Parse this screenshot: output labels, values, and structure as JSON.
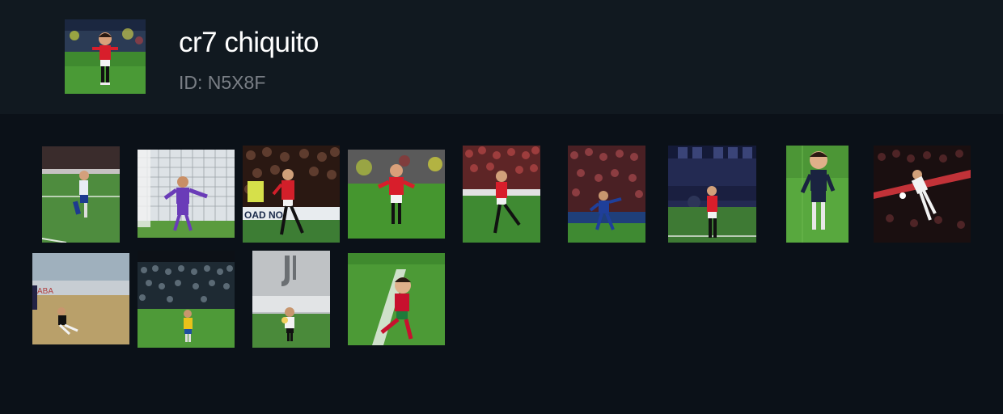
{
  "collection": {
    "title": "cr7 chiquito",
    "id_text": "ID: N5X8F"
  },
  "gallery": {
    "items": [
      {
        "scene": "white-kit-small-player",
        "kit": "#e9ecf5"
      },
      {
        "scene": "purple-kit-goal-net",
        "kit": "#6a3cb8"
      },
      {
        "scene": "red-kit-crowd-night",
        "kit": "#d21f2a"
      },
      {
        "scene": "red-kit-stadium-green",
        "kit": "#d81e2b"
      },
      {
        "scene": "red-kit-running-crowd",
        "kit": "#d81e2b"
      },
      {
        "scene": "blue-kit-sprint",
        "kit": "#1f3f9a"
      },
      {
        "scene": "red-kit-dugout",
        "kit": "#d81e2b"
      },
      {
        "scene": "navy-kit-big-head",
        "kit": "#1a2340"
      },
      {
        "scene": "white-kit-bicycle-kick",
        "kit": "#f2f2f2"
      },
      {
        "scene": "white-kit-slide",
        "kit": "#f2f2f2"
      },
      {
        "scene": "yellow-kit-crowd",
        "kit": "#e8c21a"
      },
      {
        "scene": "juventus-kit-training",
        "kit": "#f2f2f2"
      },
      {
        "scene": "portugal-kit-running",
        "kit": "#c8102e"
      }
    ]
  }
}
